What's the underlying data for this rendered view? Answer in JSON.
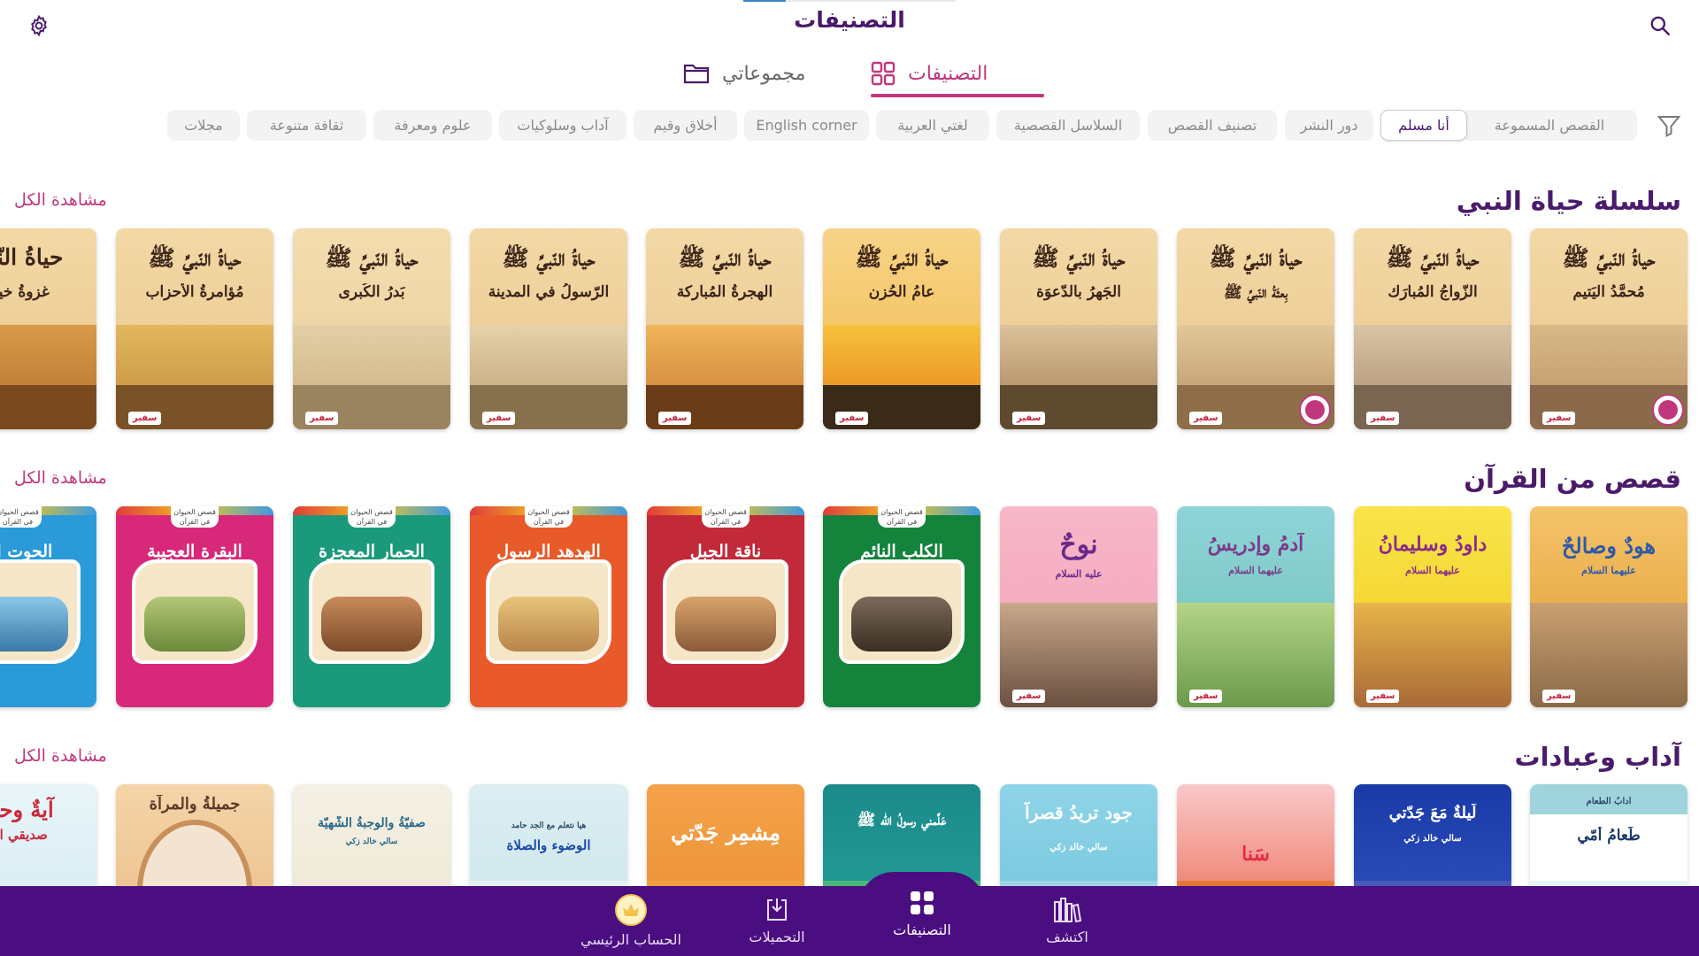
{
  "header": {
    "title": "التصنيفات",
    "settings_icon": "gear-icon",
    "search_icon": "search-icon"
  },
  "tabs": [
    {
      "label": "مجموعاتي",
      "icon": "folder-icon",
      "active": false
    },
    {
      "label": "التصنيفات",
      "icon": "grid-icon",
      "active": true
    }
  ],
  "filters": {
    "icon": "filter-icon",
    "chips": [
      {
        "label": "القصص المسموعة",
        "active": false
      },
      {
        "label": "أنا مسلم",
        "active": true
      },
      {
        "label": "دور النشر",
        "active": false
      },
      {
        "label": "تصنيف القصص",
        "active": false
      },
      {
        "label": "السلاسل القصصية",
        "active": false
      },
      {
        "label": "لغتي العربية",
        "active": false
      },
      {
        "label": "English corner",
        "active": false
      },
      {
        "label": "أخلاق وقيم",
        "active": false
      },
      {
        "label": "آداب وسلوكيات",
        "active": false
      },
      {
        "label": "علوم ومعرفة",
        "active": false
      },
      {
        "label": "ثقافة متنوعة",
        "active": false
      },
      {
        "label": "مجلات",
        "active": false
      }
    ]
  },
  "sections": [
    {
      "title": "سلسلة حياة النبي",
      "see_all": "مشاهدة الكل",
      "books": [
        {
          "series": "حياةُ النّبيِّ ﷺ",
          "title": "مُحمَّدُ اليَتيم",
          "publisher": "سفير",
          "audio": true
        },
        {
          "series": "حياةُ النّبيِّ ﷺ",
          "title": "الزّواجُ المُبارَك",
          "publisher": "سفير",
          "audio": false
        },
        {
          "series": "حياةُ النّبيِّ ﷺ",
          "title": "بِعثَةُ النّبيِّ ﷺ",
          "publisher": "سفير",
          "audio": true
        },
        {
          "series": "حياةُ النّبيِّ ﷺ",
          "title": "الجَهرُ بالدّعوَة",
          "publisher": "سفير",
          "audio": false
        },
        {
          "series": "حياةُ النّبيِّ ﷺ",
          "title": "عامُ الحُزن",
          "publisher": "سفير",
          "audio": false
        },
        {
          "series": "حياةُ النّبيِّ ﷺ",
          "title": "الهِجرةُ المُباركة",
          "publisher": "سفير",
          "audio": false
        },
        {
          "series": "حياةُ النّبيِّ ﷺ",
          "title": "الرّسولُ في المدينة",
          "publisher": "سفير",
          "audio": false
        },
        {
          "series": "حياةُ النّبيِّ ﷺ",
          "title": "بَدرُ الكُبرى",
          "publisher": "سفير",
          "audio": false
        },
        {
          "series": "حياةُ النّبيِّ ﷺ",
          "title": "مُؤامرةُ الأحزاب",
          "publisher": "سفير",
          "audio": false
        },
        {
          "series": "حياةُ النّبيِّ",
          "title": "غزوةُ خيبر",
          "publisher": "",
          "audio": false
        }
      ]
    },
    {
      "title": "قصص من القرآن",
      "see_all": "مشاهدة الكل",
      "books": [
        {
          "series": "",
          "title": "هودٌ وصالحٌ",
          "subtitle": "عليهما السلام",
          "publisher": "سفير"
        },
        {
          "series": "",
          "title": "داودُ وسليمانُ",
          "subtitle": "عليهما السلام",
          "publisher": "سفير"
        },
        {
          "series": "",
          "title": "آدمُ وإدريسُ",
          "subtitle": "عليهما السلام",
          "publisher": "سفير"
        },
        {
          "series": "",
          "title": "نوحٌ",
          "subtitle": "عليه السلام",
          "publisher": "سفير"
        },
        {
          "series": "قصص الحيوان في القرآن",
          "title": "الكلب النائم",
          "publisher": ""
        },
        {
          "series": "قصص الحيوان في القرآن",
          "title": "ناقة الجبل",
          "publisher": ""
        },
        {
          "series": "قصص الحيوان في القرآن",
          "title": "الهدهد الرسول",
          "publisher": ""
        },
        {
          "series": "قصص الحيوان في القرآن",
          "title": "الحمار المعجزة",
          "publisher": ""
        },
        {
          "series": "قصص الحيوان في القرآن",
          "title": "البقرة العجيبة",
          "publisher": ""
        },
        {
          "series": "قصص الحيوان في القرآن",
          "title": "الحوت الذ",
          "publisher": ""
        }
      ]
    },
    {
      "title": "آداب وعبادات",
      "see_all": "مشاهدة الكل",
      "books": [
        {
          "title": "طَعامُ أُمّي",
          "header_text": "آدابُ الطّعامِ"
        },
        {
          "title": "لَيلةٌ مَعَ جَدّتي",
          "subtitle": "سالي خالد زكي"
        },
        {
          "title": "سَنا",
          "subtitle": ""
        },
        {
          "title": "جود تريدُ قصراً",
          "subtitle": "سالي خالد زكي"
        },
        {
          "title": "عَلَّمني رسولُ اللّه ﷺ",
          "subtitle": ""
        },
        {
          "title": "مِشمِر جَدّتي",
          "subtitle": ""
        },
        {
          "title": "الوضوء والصلاة",
          "subtitle": "هيا نتعلم مع الجد حامد"
        },
        {
          "title": "صفيّةُ والوجبةُ الشّهيّة",
          "subtitle": "سالي خالد زكي"
        },
        {
          "title": "جميلةُ والمرآة",
          "subtitle": ""
        },
        {
          "title": "آيةٌ وحكـ",
          "subtitle": "صديقي البـ"
        }
      ]
    }
  ],
  "bottom_nav": [
    {
      "label": "اكتشف",
      "icon": "library-icon",
      "active": false
    },
    {
      "label": "التصنيفات",
      "icon": "grid-icon",
      "active": true
    },
    {
      "label": "التحميلات",
      "icon": "download-icon",
      "active": false
    },
    {
      "label": "الحساب الرئيسي",
      "icon": "avatar-crown-icon",
      "active": false
    }
  ],
  "colors": {
    "brand_purple": "#4a0e80",
    "title_purple": "#4a1a6b",
    "accent_pink": "#c0387c"
  }
}
